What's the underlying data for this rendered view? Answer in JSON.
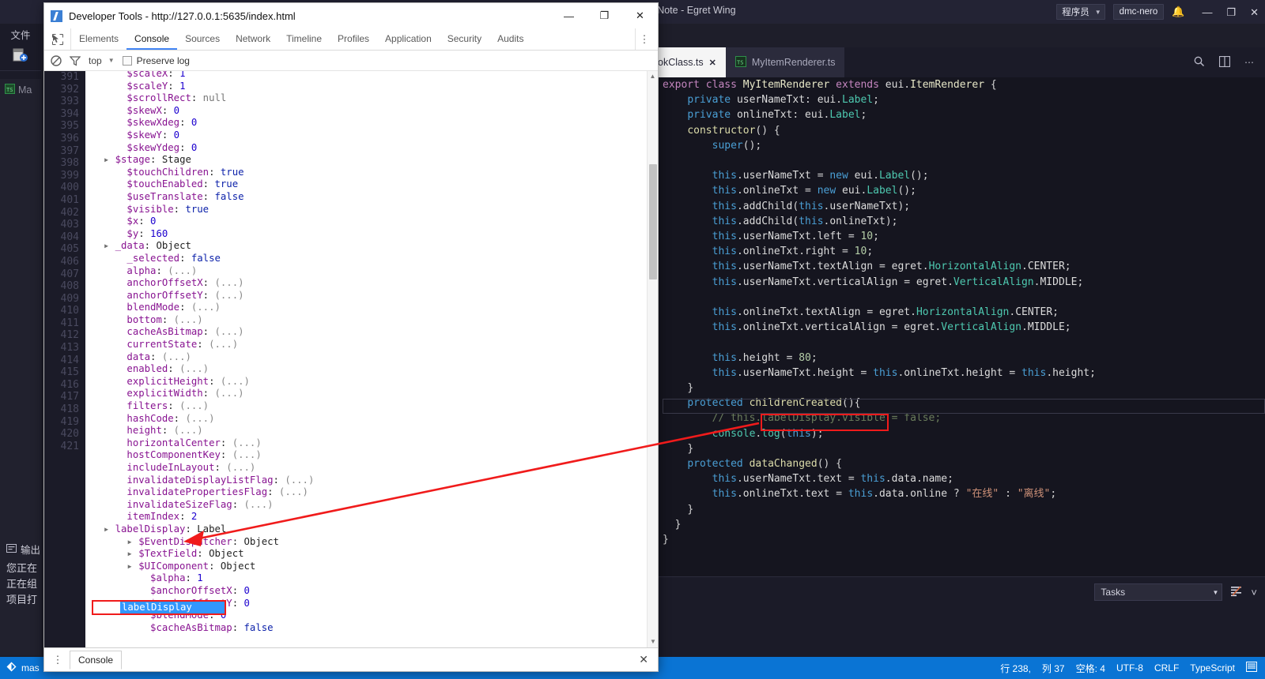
{
  "wing": {
    "title": "OfNote - Egret Wing",
    "role_select": {
      "value": "程序员",
      "caret": "▼"
    },
    "user": "dmc-nero",
    "bell_icon": "bell-icon",
    "window_controls": {
      "minimize": "—",
      "maximize": "❐",
      "close": "✕"
    },
    "left_rail": {
      "label": "文件",
      "new_file_icon": "new-file-icon"
    },
    "explorer": {
      "items": [
        "Ma"
      ]
    },
    "output": {
      "title": "输出",
      "lines": [
        "您正在",
        "正在组",
        "项目打"
      ]
    },
    "tabs": [
      {
        "label": "okClass.ts",
        "active": false,
        "dirty": false,
        "close": "✕"
      },
      {
        "label": "MyItemRenderer.ts",
        "active": true,
        "close": ""
      }
    ],
    "tabstrip_actions": [
      "search-in-file-icon",
      "split-editor-icon",
      "more-actions-icon"
    ],
    "panel": {
      "tasks_label": "Tasks",
      "tasks_caret": "▼",
      "clear_icon": "clear-output-icon",
      "collapse_icon": "chevron-down-icon"
    },
    "statusbar": {
      "branch_icon": "source-control-icon",
      "branch": "mas",
      "line": "行 238,",
      "column": "列 37",
      "indent": "空格: 4",
      "encoding": "UTF-8",
      "eol": "CRLF",
      "language": "TypeScript",
      "notify_icon": "notifications-icon"
    },
    "editor": {
      "code_lines": [
        "export class MyItemRenderer extends eui.ItemRenderer {",
        "    private userNameTxt: eui.Label;",
        "    private onlineTxt: eui.Label;",
        "    constructor() {",
        "        super();",
        "",
        "        this.userNameTxt = new eui.Label();",
        "        this.onlineTxt = new eui.Label();",
        "        this.addChild(this.userNameTxt);",
        "        this.addChild(this.onlineTxt);",
        "        this.userNameTxt.left = 10;",
        "        this.onlineTxt.right = 10;",
        "        this.userNameTxt.textAlign = egret.HorizontalAlign.CENTER;",
        "        this.userNameTxt.verticalAlign = egret.VerticalAlign.MIDDLE;",
        "",
        "        this.onlineTxt.textAlign = egret.HorizontalAlign.CENTER;",
        "        this.onlineTxt.verticalAlign = egret.VerticalAlign.MIDDLE;",
        "",
        "        this.height = 80;",
        "        this.userNameTxt.height = this.onlineTxt.height = this.height;",
        "    }",
        "    protected childrenCreated(){",
        "        // this.labelDisplay.visible = false;",
        "        console.log(this);",
        "    }",
        "    protected dataChanged() {",
        "        this.userNameTxt.text = this.data.name;",
        "        this.onlineTxt.text = this.data.online ? \"在线\" : \"离线\";",
        "    }",
        "}",
        "}"
      ],
      "highlighted_statement": "console.log(this);"
    }
  },
  "devtools": {
    "window_title": "Developer Tools - http://127.0.0.1:5635/index.html",
    "window_controls": {
      "minimize": "—",
      "maximize": "❐",
      "close": "✕"
    },
    "tabs": [
      "Elements",
      "Console",
      "Sources",
      "Network",
      "Timeline",
      "Profiles",
      "Application",
      "Security",
      "Audits"
    ],
    "active_tab": "Console",
    "inspect_icon": "inspect-element-icon",
    "more_icon": "more-options-icon",
    "toolbar": {
      "clear_icon": "clear-console-icon",
      "filter_icon": "filter-icon",
      "context": "top",
      "context_caret": "▼",
      "preserve_log_label": "Preserve log",
      "preserve_log_checked": false
    },
    "drawer": {
      "tab": "Console",
      "close": "✕"
    },
    "line_numbers": [
      391,
      392,
      393,
      394,
      395,
      396,
      397,
      398,
      399,
      400,
      401,
      402,
      403,
      404,
      405,
      406,
      407,
      408,
      409,
      410,
      411,
      412,
      413,
      414,
      415,
      416,
      417,
      418,
      419,
      420,
      421
    ],
    "selected_property": "labelDisplay",
    "console_properties": [
      {
        "indent": 2,
        "tri": false,
        "key": "$scaleX",
        "val": "1",
        "vtype": "num"
      },
      {
        "indent": 2,
        "tri": false,
        "key": "$scaleY",
        "val": "1",
        "vtype": "num"
      },
      {
        "indent": 2,
        "tri": false,
        "key": "$scrollRect",
        "val": "null",
        "vtype": "null"
      },
      {
        "indent": 2,
        "tri": false,
        "key": "$skewX",
        "val": "0",
        "vtype": "num"
      },
      {
        "indent": 2,
        "tri": false,
        "key": "$skewXdeg",
        "val": "0",
        "vtype": "num"
      },
      {
        "indent": 2,
        "tri": false,
        "key": "$skewY",
        "val": "0",
        "vtype": "num"
      },
      {
        "indent": 2,
        "tri": false,
        "key": "$skewYdeg",
        "val": "0",
        "vtype": "num"
      },
      {
        "indent": 1,
        "tri": true,
        "key": "$stage",
        "val": "Stage",
        "vtype": "obj"
      },
      {
        "indent": 2,
        "tri": false,
        "key": "$touchChildren",
        "val": "true",
        "vtype": "bool"
      },
      {
        "indent": 2,
        "tri": false,
        "key": "$touchEnabled",
        "val": "true",
        "vtype": "bool"
      },
      {
        "indent": 2,
        "tri": false,
        "key": "$useTranslate",
        "val": "false",
        "vtype": "bool"
      },
      {
        "indent": 2,
        "tri": false,
        "key": "$visible",
        "val": "true",
        "vtype": "bool"
      },
      {
        "indent": 2,
        "tri": false,
        "key": "$x",
        "val": "0",
        "vtype": "num"
      },
      {
        "indent": 2,
        "tri": false,
        "key": "$y",
        "val": "160",
        "vtype": "num"
      },
      {
        "indent": 1,
        "tri": true,
        "key": "_data",
        "val": "Object",
        "vtype": "obj"
      },
      {
        "indent": 2,
        "tri": false,
        "key": "_selected",
        "val": "false",
        "vtype": "bool"
      },
      {
        "indent": 2,
        "tri": false,
        "key": "alpha",
        "val": "(...)",
        "vtype": "dots"
      },
      {
        "indent": 2,
        "tri": false,
        "key": "anchorOffsetX",
        "val": "(...)",
        "vtype": "dots"
      },
      {
        "indent": 2,
        "tri": false,
        "key": "anchorOffsetY",
        "val": "(...)",
        "vtype": "dots"
      },
      {
        "indent": 2,
        "tri": false,
        "key": "blendMode",
        "val": "(...)",
        "vtype": "dots"
      },
      {
        "indent": 2,
        "tri": false,
        "key": "bottom",
        "val": "(...)",
        "vtype": "dots"
      },
      {
        "indent": 2,
        "tri": false,
        "key": "cacheAsBitmap",
        "val": "(...)",
        "vtype": "dots"
      },
      {
        "indent": 2,
        "tri": false,
        "key": "currentState",
        "val": "(...)",
        "vtype": "dots"
      },
      {
        "indent": 2,
        "tri": false,
        "key": "data",
        "val": "(...)",
        "vtype": "dots"
      },
      {
        "indent": 2,
        "tri": false,
        "key": "enabled",
        "val": "(...)",
        "vtype": "dots"
      },
      {
        "indent": 2,
        "tri": false,
        "key": "explicitHeight",
        "val": "(...)",
        "vtype": "dots"
      },
      {
        "indent": 2,
        "tri": false,
        "key": "explicitWidth",
        "val": "(...)",
        "vtype": "dots"
      },
      {
        "indent": 2,
        "tri": false,
        "key": "filters",
        "val": "(...)",
        "vtype": "dots"
      },
      {
        "indent": 2,
        "tri": false,
        "key": "hashCode",
        "val": "(...)",
        "vtype": "dots"
      },
      {
        "indent": 2,
        "tri": false,
        "key": "height",
        "val": "(...)",
        "vtype": "dots"
      },
      {
        "indent": 2,
        "tri": false,
        "key": "horizontalCenter",
        "val": "(...)",
        "vtype": "dots"
      },
      {
        "indent": 2,
        "tri": false,
        "key": "hostComponentKey",
        "val": "(...)",
        "vtype": "dots"
      },
      {
        "indent": 2,
        "tri": false,
        "key": "includeInLayout",
        "val": "(...)",
        "vtype": "dots"
      },
      {
        "indent": 2,
        "tri": false,
        "key": "invalidateDisplayListFlag",
        "val": "(...)",
        "vtype": "dots"
      },
      {
        "indent": 2,
        "tri": false,
        "key": "invalidatePropertiesFlag",
        "val": "(...)",
        "vtype": "dots"
      },
      {
        "indent": 2,
        "tri": false,
        "key": "invalidateSizeFlag",
        "val": "(...)",
        "vtype": "dots"
      },
      {
        "indent": 2,
        "tri": false,
        "key": "itemIndex",
        "val": "2",
        "vtype": "num"
      },
      {
        "indent": 1,
        "tri": true,
        "key": "labelDisplay",
        "val": "Label",
        "vtype": "obj",
        "selected": true
      },
      {
        "indent": 3,
        "tri": true,
        "key": "$EventDispatcher",
        "val": "Object",
        "vtype": "obj"
      },
      {
        "indent": 3,
        "tri": true,
        "key": "$TextField",
        "val": "Object",
        "vtype": "obj"
      },
      {
        "indent": 3,
        "tri": true,
        "key": "$UIComponent",
        "val": "Object",
        "vtype": "obj"
      },
      {
        "indent": 4,
        "tri": false,
        "key": "$alpha",
        "val": "1",
        "vtype": "num"
      },
      {
        "indent": 4,
        "tri": false,
        "key": "$anchorOffsetX",
        "val": "0",
        "vtype": "num"
      },
      {
        "indent": 4,
        "tri": false,
        "key": "$anchorOffsetY",
        "val": "0",
        "vtype": "num"
      },
      {
        "indent": 4,
        "tri": false,
        "key": "$blendMode",
        "val": "0",
        "vtype": "num"
      },
      {
        "indent": 4,
        "tri": false,
        "key": "$cacheAsBitmap",
        "val": "false",
        "vtype": "bool"
      }
    ]
  },
  "colors": {
    "accent_blue": "#0a74d4",
    "devtools_tab_underline": "#4285f4",
    "annotation_red": "#f01b1b",
    "selection_blue": "#3297fd",
    "editor_bg": "#15151f",
    "wing_bg": "#1b1b28"
  }
}
